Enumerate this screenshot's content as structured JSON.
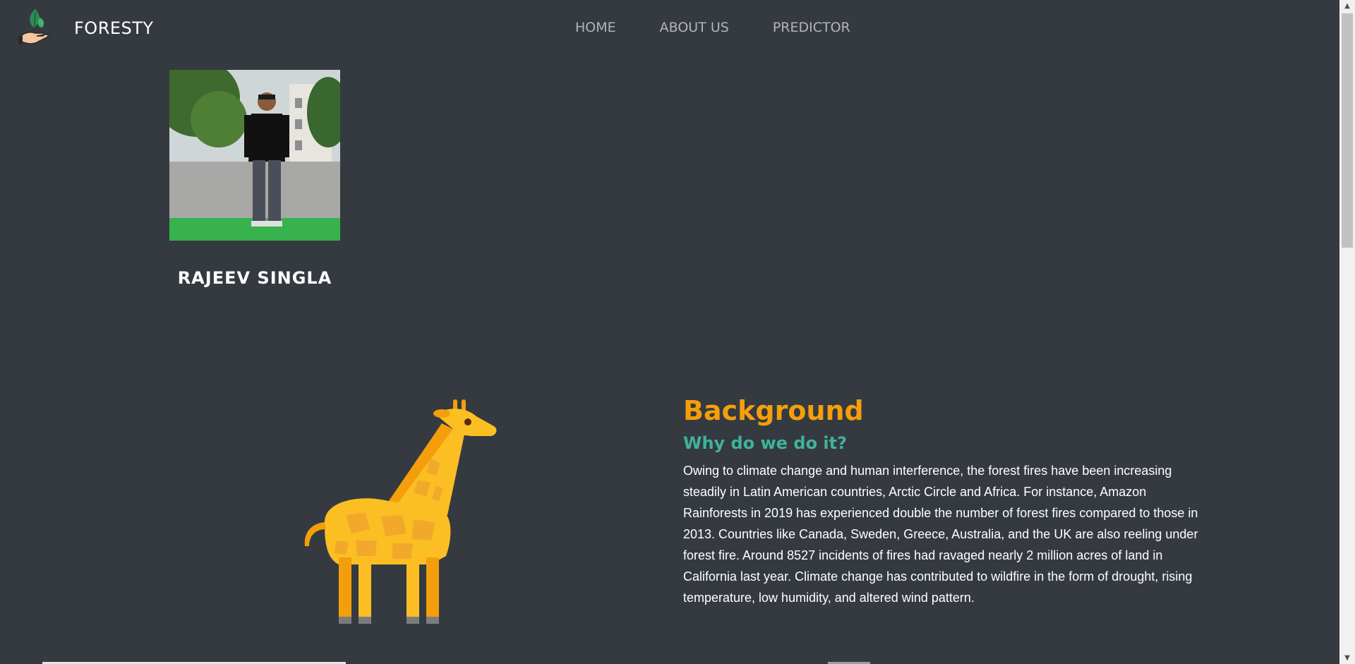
{
  "brand": {
    "name": "FORESTY",
    "logo_icon": "leaf-hand-icon"
  },
  "nav": {
    "items": [
      {
        "label": "HOME"
      },
      {
        "label": "ABOUT US"
      },
      {
        "label": "PREDICTOR"
      }
    ]
  },
  "profile": {
    "name": "RAJEEV SINGLA",
    "photo_icon": "profile-photo"
  },
  "background": {
    "illustration_icon": "giraffe-icon",
    "title": "Background",
    "subtitle": "Why do we do it?",
    "paragraph": "Owing to climate change and human interference, the forest fires have been increasing steadily in Latin American countries, Arctic Circle and Africa. For instance, Amazon Rainforests in 2019 has experienced double the number of forest fires compared to those in 2013. Countries like Canada, Sweden, Greece, Australia, and the UK are also reeling under forest fire. Around 8527 incidents of fires had ravaged nearly 2 million acres of land in California last year. Climate change has contributed to wildfire in the form of drought, rising temperature, low humidity, and altered wind pattern."
  },
  "colors": {
    "page_bg": "#343a40",
    "title_orange": "#f59e0b",
    "subtitle_teal": "#3fb39a"
  }
}
